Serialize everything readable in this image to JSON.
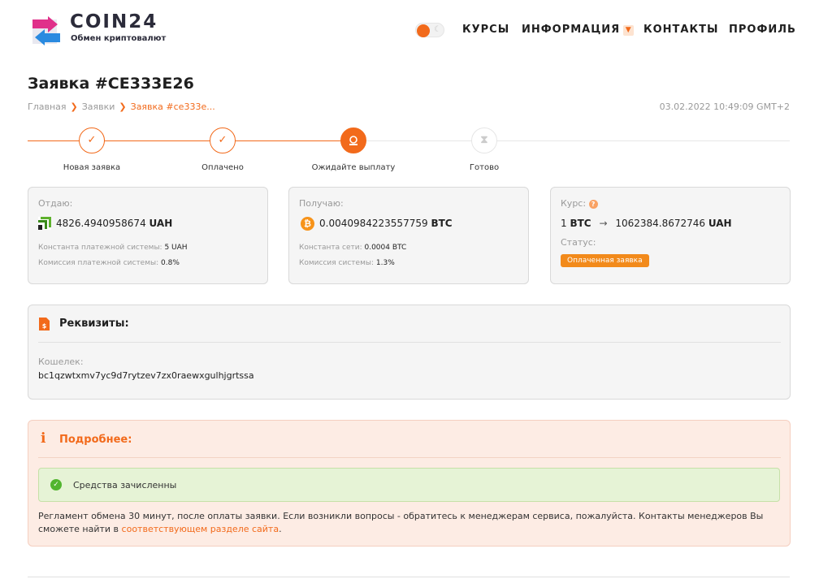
{
  "header": {
    "logo_title": "COIN24",
    "logo_subtitle": "Обмен криптовалют",
    "nav": [
      "КУРСЫ",
      "ИНФОРМАЦИЯ",
      "КОНТАКТЫ",
      "ПРОФИЛЬ"
    ],
    "theme_toggle_on": true
  },
  "page": {
    "title": "Заявка #CE333E26",
    "breadcrumb": [
      "Главная",
      "Заявки",
      "Заявка #ce333e..."
    ],
    "datetime": "03.02.2022 10:49:09 GMT+2"
  },
  "steps": [
    {
      "label": "Новая заявка",
      "state": "done",
      "icon": "check-icon"
    },
    {
      "label": "Оплачено",
      "state": "done",
      "icon": "check-icon"
    },
    {
      "label": "Ожидайте выплату",
      "state": "active",
      "icon": "payout-icon"
    },
    {
      "label": "Готово",
      "state": "pending",
      "icon": "hourglass-icon"
    }
  ],
  "give": {
    "label": "Отдаю:",
    "amount": "4826.4940958674",
    "currency": "UAH",
    "icon": "privatbank-icon",
    "const_label": "Константа платежной системы:",
    "const_value": "5 UAH",
    "fee_label": "Комиссия платежной системы:",
    "fee_value": "0.8%"
  },
  "receive": {
    "label": "Получаю:",
    "amount": "0.0040984223557759",
    "currency": "BTC",
    "icon": "bitcoin-icon",
    "const_label": "Константа сети:",
    "const_value": "0.0004 BTC",
    "fee_label": "Комиссия системы:",
    "fee_value": "1.3%"
  },
  "rate": {
    "label": "Курс:",
    "from_amount": "1",
    "from_currency": "BTC",
    "to_amount": "1062384.8672746",
    "to_currency": "UAH",
    "status_label": "Статус:",
    "status_value": "Оплаченная заявка"
  },
  "requisites": {
    "title": "Реквизиты:",
    "wallet_label": "Кошелек:",
    "wallet_value": "bc1qzwtxmv7yc9d7rytzev7zx0raewxgulhjgrtssa"
  },
  "details": {
    "title": "Подробнее:",
    "success_text": "Средства зачисленны",
    "info_text_1": "Регламент обмена 30 минут, после оплаты заявки. Если возникли вопросы - обратитесь к менеджерам сервиса, пожалуйста. Контакты менеджеров Вы",
    "info_text_2": "сможете найти в ",
    "info_link": "соответствующем разделе сайта",
    "info_text_end": "."
  },
  "colors": {
    "accent": "#f26a1b",
    "success": "#52b52f",
    "details_bg": "#fdece4"
  }
}
